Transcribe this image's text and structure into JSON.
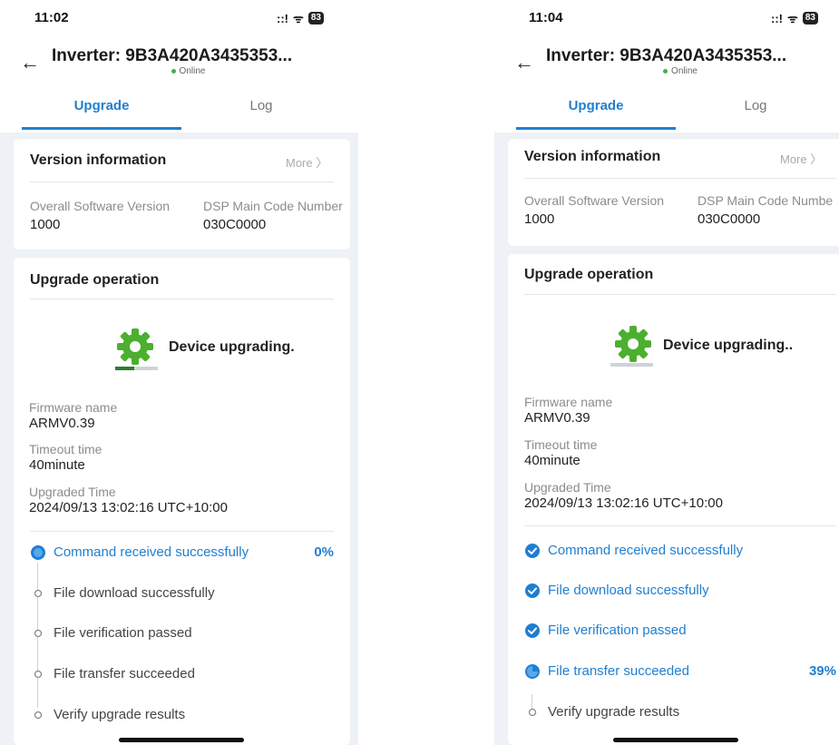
{
  "screens": [
    {
      "status": {
        "time": "11:02",
        "signal": "::!",
        "wifi": "ᯤ",
        "battery": "83"
      },
      "header": {
        "title": "Inverter: 9B3A420A3435353...",
        "online": "Online"
      },
      "tabs": [
        {
          "label": "Upgrade",
          "active": true
        },
        {
          "label": "Log",
          "active": false
        }
      ],
      "version_card": {
        "title": "Version information",
        "more": "More",
        "fields": [
          {
            "label": "Overall Software Version",
            "value": "1000"
          },
          {
            "label": "DSP Main Code Number",
            "value": "030C0000"
          }
        ]
      },
      "upgrade_card": {
        "title": "Upgrade operation",
        "status_text": "Device upgrading.",
        "progress": 0.45,
        "fields": [
          {
            "label": "Firmware name",
            "value": "ARMV0.39"
          },
          {
            "label": "Timeout time",
            "value": "40minute"
          },
          {
            "label": "Upgraded Time",
            "value": "2024/09/13 13:02:16 UTC+10:00"
          }
        ],
        "steps": [
          {
            "label": "Command received successfully",
            "state": "active",
            "percent": "0%"
          },
          {
            "label": "File download successfully",
            "state": "pending",
            "percent": ""
          },
          {
            "label": "File verification passed",
            "state": "pending",
            "percent": ""
          },
          {
            "label": "File transfer succeeded",
            "state": "pending",
            "percent": ""
          },
          {
            "label": "Verify upgrade results",
            "state": "pending",
            "percent": ""
          }
        ]
      }
    },
    {
      "status": {
        "time": "11:04",
        "signal": "::!",
        "wifi": "ᯤ",
        "battery": "83"
      },
      "header": {
        "title": "Inverter: 9B3A420A3435353...",
        "online": "Online"
      },
      "tabs": [
        {
          "label": "Upgrade",
          "active": true
        },
        {
          "label": "Log",
          "active": false
        }
      ],
      "version_card": {
        "title": "Version information",
        "more": "More",
        "fields": [
          {
            "label": "Overall Software Version",
            "value": "1000"
          },
          {
            "label": "DSP Main Code Numbe",
            "value": "030C0000"
          }
        ]
      },
      "upgrade_card": {
        "title": "Upgrade operation",
        "status_text": "Device upgrading..",
        "progress": 0.0,
        "fields": [
          {
            "label": "Firmware name",
            "value": "ARMV0.39"
          },
          {
            "label": "Timeout time",
            "value": "40minute"
          },
          {
            "label": "Upgraded Time",
            "value": "2024/09/13 13:02:16 UTC+10:00"
          }
        ],
        "steps": [
          {
            "label": "Command received successfully",
            "state": "done",
            "percent": ""
          },
          {
            "label": "File download successfully",
            "state": "done",
            "percent": ""
          },
          {
            "label": "File verification passed",
            "state": "done",
            "percent": ""
          },
          {
            "label": "File transfer succeeded",
            "state": "active",
            "percent": "39%"
          },
          {
            "label": "Verify upgrade results",
            "state": "pending",
            "percent": ""
          }
        ]
      }
    }
  ],
  "colors": {
    "accent": "#1f7fd1",
    "gear": "#4caf2e",
    "progress": "#2e7d32",
    "online": "#3bb34a"
  }
}
